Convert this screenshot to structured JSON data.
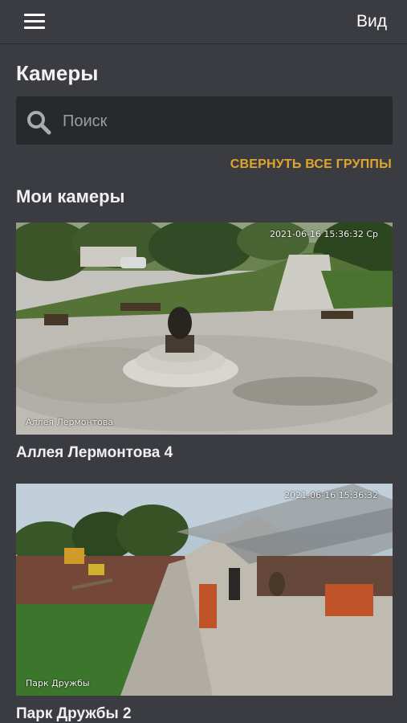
{
  "header": {
    "menu_icon": "hamburger-menu-icon",
    "view_label": "Вид"
  },
  "page": {
    "title": "Камеры"
  },
  "search": {
    "icon": "search-icon",
    "placeholder": "Поиск",
    "value": ""
  },
  "collapse_all_label": "СВЕРНУТЬ ВСЕ ГРУППЫ",
  "section": {
    "title": "Мои камеры"
  },
  "cameras": [
    {
      "title": "Аллея Лермонтова 4",
      "overlay_timestamp": "2021-06-16 15:36:32 Ср",
      "overlay_name": "Аллея Лермонтова"
    },
    {
      "title": "Парк Дружбы 2",
      "overlay_timestamp": "2021-06-16 15:36:32",
      "overlay_name": "Парк Дружбы"
    }
  ],
  "colors": {
    "background": "#3a3c41",
    "search_bg": "#27292d",
    "accent": "#e0a52c"
  }
}
